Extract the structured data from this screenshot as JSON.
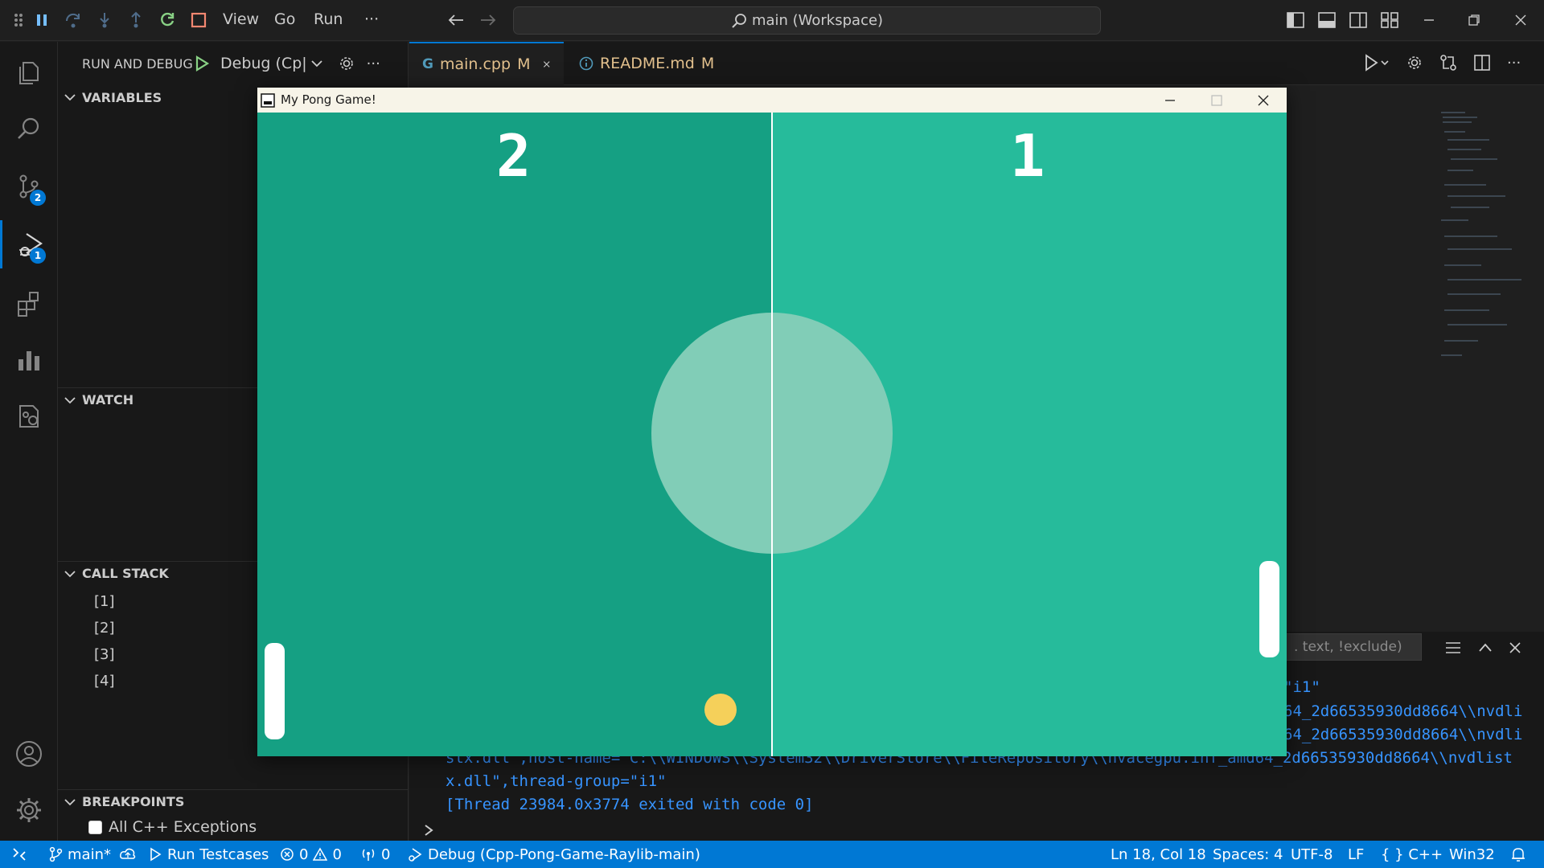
{
  "titlebar": {
    "menu": [
      "View",
      "Go",
      "Run",
      "···"
    ],
    "command_center": "main (Workspace)"
  },
  "activity": {
    "scm_badge": "2",
    "debug_badge": "1"
  },
  "sidebar": {
    "title": "RUN AND DEBUG",
    "debug_config": "Debug (Cp|",
    "sections": {
      "variables": "VARIABLES",
      "watch": "WATCH",
      "call_stack": "CALL STACK",
      "breakpoints": "BREAKPOINTS"
    },
    "call_stack_items": [
      "[1]",
      "[2]",
      "[3]",
      "[4]"
    ],
    "breakpoint_label": "All C++ Exceptions"
  },
  "tabs": [
    {
      "label": "main.cpp",
      "modified": "M"
    },
    {
      "label": "README.md",
      "modified": "M"
    }
  ],
  "panel": {
    "filter_placeholder": ". text, !exclude)",
    "lines": [
      "\"i1\"",
      "64_2d66535930dd8664\\\\nvdli",
      "64_2d66535930dd8664\\\\nvdli",
      "stx.dll\",host-name=\"C:\\\\WINDOWS\\\\System32\\\\DriverStore\\\\FileRepository\\\\nvacegpu.inf_amd64_2d66535930dd8664\\\\nvdlist",
      "x.dll\",thread-group=\"i1\"",
      "[Thread 23984.0x3774 exited with code 0]"
    ]
  },
  "statusbar": {
    "branch": "main*",
    "run_testcases": "Run Testcases",
    "errors": "0",
    "warnings": "0",
    "ports": "0",
    "debug": "Debug (Cpp-Pong-Game-Raylib-main)",
    "position": "Ln 18, Col 18",
    "spaces": "Spaces: 4",
    "encoding": "UTF-8",
    "eol": "LF",
    "language": "{ } C++",
    "platform": "Win32"
  },
  "game": {
    "title": "My Pong Game!",
    "score_left": "2",
    "score_right": "1",
    "colors": {
      "left_half": "#15a083",
      "right_half": "#26bb9b",
      "circle": "#81cdb7",
      "ball": "#f5d05a"
    }
  }
}
